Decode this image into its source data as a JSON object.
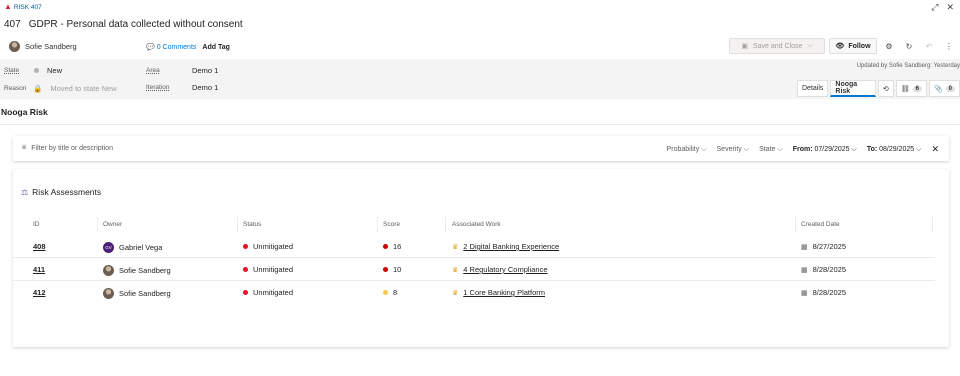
{
  "window": {
    "item_type": "RISK 407",
    "controls": [
      "expand-icon",
      "close-icon"
    ]
  },
  "work_item": {
    "id": "407",
    "title": "GDPR - Personal data collected without consent",
    "owner": "Sofie Sandberg",
    "comments_label": "0 Comments",
    "add_tag_label": "Add Tag"
  },
  "toolbar": {
    "save_label": "Save and Close",
    "follow_label": "Follow"
  },
  "fields": {
    "state_label": "State",
    "state_value": "New",
    "reason_label": "Reason",
    "reason_value": "Moved to state New",
    "area_label": "Area",
    "area_value": "Demo 1",
    "iteration_label": "Iteration",
    "iteration_value": "Demo 1",
    "updated_text": "Updated by Sofie Sandberg: Yesterday"
  },
  "tabs": {
    "details": "Details",
    "nooga": "Nooga Risk",
    "links_count": "6",
    "attachments_count": "0"
  },
  "section": {
    "title": "Nooga Risk"
  },
  "filter": {
    "placeholder": "Filter by title or description",
    "probability": "Probability",
    "severity": "Severity",
    "state": "State",
    "from_label": "From:",
    "from_value": "07/29/2025",
    "to_label": "To:",
    "to_value": "08/29/2025"
  },
  "assessments": {
    "title": "Risk Assessments",
    "columns": {
      "id": "ID",
      "owner": "Owner",
      "status": "Status",
      "score": "Score",
      "work": "Associated Work",
      "created": "Created Date"
    },
    "rows": [
      {
        "id": "408",
        "owner": "Gabriel Vega",
        "initials": "GV",
        "status": "Unmitigated",
        "status_color": "#e81123",
        "score": "16",
        "score_color": "#cc0000",
        "work": "2 Digital Banking Experience",
        "created": "8/27/2025"
      },
      {
        "id": "411",
        "owner": "Sofie Sandberg",
        "initials": "",
        "status": "Unmitigated",
        "status_color": "#e81123",
        "score": "10",
        "score_color": "#cc0000",
        "work": "4 Regulatory Compliance",
        "created": "8/28/2025"
      },
      {
        "id": "412",
        "owner": "Sofie Sandberg",
        "initials": "",
        "status": "Unmitigated",
        "status_color": "#e81123",
        "score": "8",
        "score_color": "#f2c94c",
        "work": "1 Core Banking Platform",
        "created": "8/28/2025"
      }
    ]
  },
  "colors": {
    "accent": "#0078d4",
    "risk_flag": "#cc293d",
    "crown": "#e8a317"
  }
}
